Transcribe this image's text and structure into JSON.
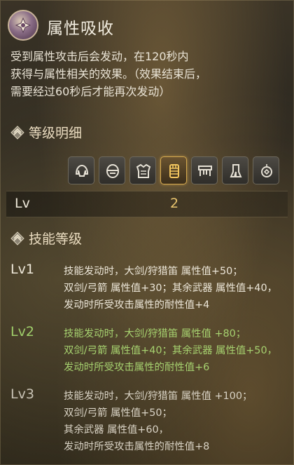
{
  "header": {
    "title": "属性吸收",
    "emblem_icon": "attribute-absorb-emblem-icon"
  },
  "description": {
    "lines": [
      "受到属性攻击后会发动，在120秒内",
      "获得与属性相关的效果。（效果结束后，",
      "需要经过60秒后才能再次发动）"
    ]
  },
  "level_detail": {
    "heading": "等级明细",
    "equipment_slots": [
      {
        "icon": "helmet-icon",
        "active": false
      },
      {
        "icon": "head-gear-icon",
        "active": false
      },
      {
        "icon": "chest-armor-icon",
        "active": false
      },
      {
        "icon": "gauntlet-icon",
        "active": true
      },
      {
        "icon": "waist-armor-icon",
        "active": false
      },
      {
        "icon": "leg-armor-icon",
        "active": false
      },
      {
        "icon": "charm-icon",
        "active": false
      }
    ],
    "level_label": "Lv",
    "level_value": "2"
  },
  "skill_levels": {
    "heading": "技能等级",
    "items": [
      {
        "tag": "Lv1",
        "lines": [
          "技能发动时，大剑/狩猎笛 属性值+50；",
          "双剑/弓箭 属性值+30；其余武器 属性值+40，",
          "发动时所受攻击属性的耐性值+4"
        ]
      },
      {
        "tag": "Lv2",
        "lines": [
          "技能发动时，大剑/狩猎笛 属性值 +80；",
          "双剑/弓箭 属性值+40；其余武器 属性值+50，",
          "发动时所受攻击属性的耐性值+6"
        ]
      },
      {
        "tag": "Lv3",
        "lines": [
          "技能发动时，大剑/狩猎笛 属性值 +100；",
          "双剑/弓箭 属性值+50；",
          "其余武器 属性值+60，",
          "发动时所受攻击属性的耐性值+8"
        ]
      }
    ]
  },
  "colors": {
    "current_level": "#a6d16f",
    "accent_gold": "#e9c56e"
  }
}
